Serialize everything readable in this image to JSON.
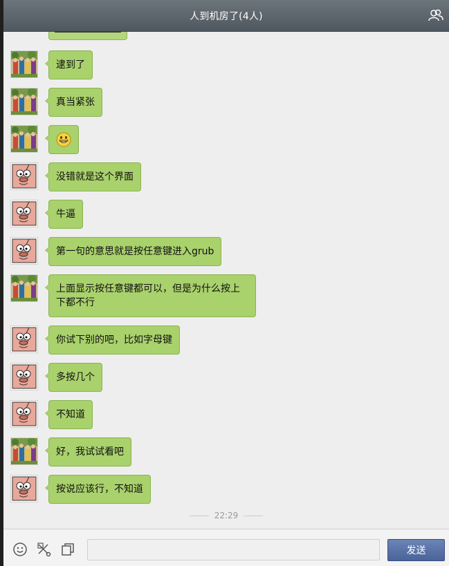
{
  "window": {
    "title": "人到机房了(4人)",
    "group_icon": "group-members-icon"
  },
  "messages": [
    {
      "sender": "a",
      "avatar": "photo-avatar",
      "text": "逮到了"
    },
    {
      "sender": "a",
      "avatar": "photo-avatar",
      "text": "真当紧张"
    },
    {
      "sender": "a",
      "avatar": "photo-avatar",
      "emoji": "grin-emoji"
    },
    {
      "sender": "b",
      "avatar": "cartoon-avatar",
      "text": "没错就是这个界面"
    },
    {
      "sender": "b",
      "avatar": "cartoon-avatar",
      "text": "牛逼"
    },
    {
      "sender": "b",
      "avatar": "cartoon-avatar",
      "text": "第一句的意思就是按任意键进入grub"
    },
    {
      "sender": "a",
      "avatar": "photo-avatar",
      "text": "上面显示按任意键都可以，但是为什么按上下都不行"
    },
    {
      "sender": "b",
      "avatar": "cartoon-avatar",
      "text": "你试下别的吧，比如字母键"
    },
    {
      "sender": "b",
      "avatar": "cartoon-avatar",
      "text": "多按几个"
    },
    {
      "sender": "b",
      "avatar": "cartoon-avatar",
      "text": "不知道"
    },
    {
      "sender": "a",
      "avatar": "photo-avatar",
      "text": "好，我试试看吧"
    },
    {
      "sender": "b",
      "avatar": "cartoon-avatar",
      "text": "按说应该行，不知道"
    }
  ],
  "timestamp": "22:29",
  "toolbar": {
    "emoji_icon": "smiley-icon",
    "screenshot_icon": "scissors-icon",
    "window_icon": "copy-icon",
    "input_value": "",
    "send_label": "发送"
  },
  "colors": {
    "bubble": "#a9d16c",
    "bubble_border": "#8ab352",
    "send_button": "#5470a8"
  }
}
